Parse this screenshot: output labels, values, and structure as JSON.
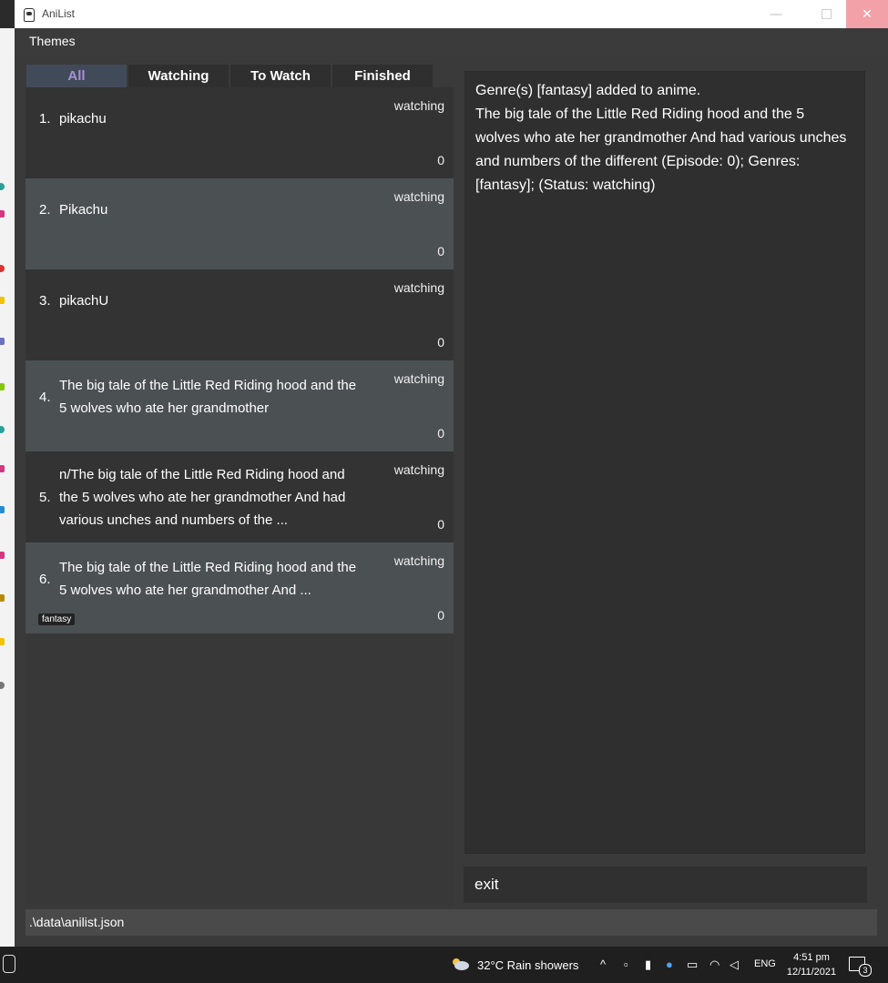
{
  "window": {
    "title": "AniList",
    "minimize": "—",
    "close": "✕"
  },
  "menu": {
    "themes": "Themes"
  },
  "tabs": [
    {
      "label": "All",
      "active": true
    },
    {
      "label": "Watching",
      "active": false
    },
    {
      "label": "To Watch",
      "active": false
    },
    {
      "label": "Finished",
      "active": false
    }
  ],
  "anime_list": [
    {
      "index": "1.",
      "name": "pikachu",
      "status": "watching",
      "episode": "0"
    },
    {
      "index": "2.",
      "name": "Pikachu",
      "status": "watching",
      "episode": "0"
    },
    {
      "index": "3.",
      "name": "pikachU",
      "status": "watching",
      "episode": "0"
    },
    {
      "index": "4.",
      "name": "The big tale of the Little Red Riding hood and the 5 wolves who ate her grandmother",
      "status": "watching",
      "episode": "0"
    },
    {
      "index": "5.",
      "name": "n/The big tale of the Little Red Riding hood and the 5 wolves who ate her grandmother And had various unches and numbers of the ...",
      "status": "watching",
      "episode": "0"
    },
    {
      "index": "6.",
      "name": "The big tale of the Little Red Riding hood and the 5 wolves who ate her grandmother And ...",
      "status": "watching",
      "episode": "0",
      "genre": "fantasy"
    }
  ],
  "result": {
    "text": "Genre(s) [fantasy] added to anime.\nThe big tale of the Little Red Riding hood and the 5 wolves who ate her grandmother And had various unches and numbers of the different (Episode: 0); Genres: [fantasy]; (Status: watching)"
  },
  "command": {
    "value": "exit"
  },
  "status_bar": {
    "path": ".\\data\\anilist.json"
  },
  "taskbar": {
    "weather": "32°C  Rain showers",
    "language": "ENG",
    "time": "4:51 pm",
    "date": "12/11/2021",
    "notifications": "3"
  },
  "colors": {
    "active_tab_text": "#a98fd6",
    "close_button": "#f2a1a8"
  }
}
